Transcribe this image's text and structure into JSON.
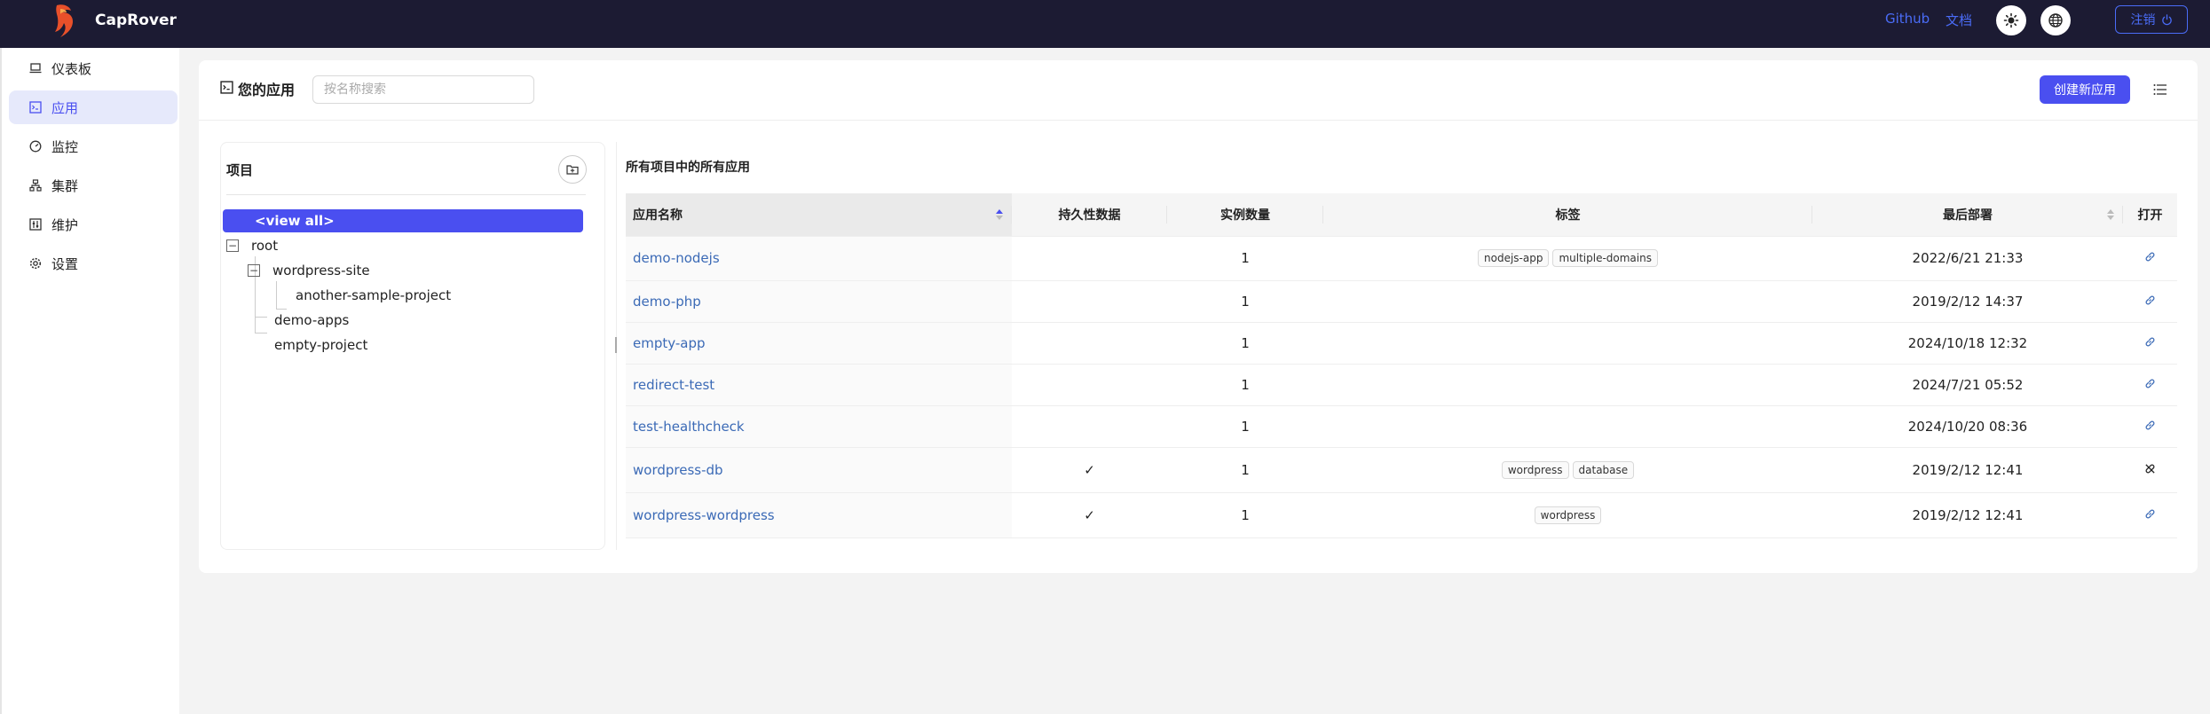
{
  "header": {
    "brand": "CapRover",
    "github": "Github",
    "docs": "文档",
    "logout": "注销",
    "theme_icon": "sun-icon",
    "lang_icon": "globe-icon",
    "logout_icon": "power-icon"
  },
  "sidebar": {
    "items": [
      {
        "label": "仪表板",
        "icon": "laptop-icon"
      },
      {
        "label": "应用",
        "icon": "code-window-icon"
      },
      {
        "label": "监控",
        "icon": "dashboard-gauge-icon"
      },
      {
        "label": "集群",
        "icon": "cluster-icon"
      },
      {
        "label": "维护",
        "icon": "control-panel-icon"
      },
      {
        "label": "设置",
        "icon": "gear-icon"
      }
    ],
    "active_index": 1
  },
  "main": {
    "title": "您的应用",
    "search_placeholder": "按名称搜索",
    "create_button": "创建新应用"
  },
  "projects": {
    "title": "项目",
    "tree": [
      {
        "label": "<view all>",
        "selected": true
      },
      {
        "label": "root"
      },
      {
        "label": "wordpress-site"
      },
      {
        "label": "another-sample-project"
      },
      {
        "label": "demo-apps"
      },
      {
        "label": "empty-project"
      }
    ]
  },
  "apps": {
    "title": "所有项目中的所有应用",
    "columns": [
      "应用名称",
      "持久性数据",
      "实例数量",
      "标签",
      "最后部署",
      "打开"
    ],
    "rows": [
      {
        "name": "demo-nodejs",
        "persistent": "",
        "instances": "1",
        "tags": [
          "nodejs-app",
          "multiple-domains"
        ],
        "deployed": "2022/6/21 21:33",
        "open_icon": "link-icon"
      },
      {
        "name": "demo-php",
        "persistent": "",
        "instances": "1",
        "tags": [],
        "deployed": "2019/2/12 14:37",
        "open_icon": "link-icon"
      },
      {
        "name": "empty-app",
        "persistent": "",
        "instances": "1",
        "tags": [],
        "deployed": "2024/10/18 12:32",
        "open_icon": "link-icon"
      },
      {
        "name": "redirect-test",
        "persistent": "",
        "instances": "1",
        "tags": [],
        "deployed": "2024/7/21 05:52",
        "open_icon": "link-icon"
      },
      {
        "name": "test-healthcheck",
        "persistent": "",
        "instances": "1",
        "tags": [],
        "deployed": "2024/10/20 08:36",
        "open_icon": "link-icon"
      },
      {
        "name": "wordpress-db",
        "persistent": "✓",
        "instances": "1",
        "tags": [
          "wordpress",
          "database"
        ],
        "deployed": "2019/2/12 12:41",
        "open_icon": "broken-link-icon"
      },
      {
        "name": "wordpress-wordpress",
        "persistent": "✓",
        "instances": "1",
        "tags": [
          "wordpress"
        ],
        "deployed": "2019/2/12 12:41",
        "open_icon": "link-icon"
      }
    ]
  },
  "colors": {
    "header_bg": "#1c1b33",
    "accent": "#4a4ff0",
    "link": "#3b6ab6",
    "logo": "#e8502a"
  }
}
